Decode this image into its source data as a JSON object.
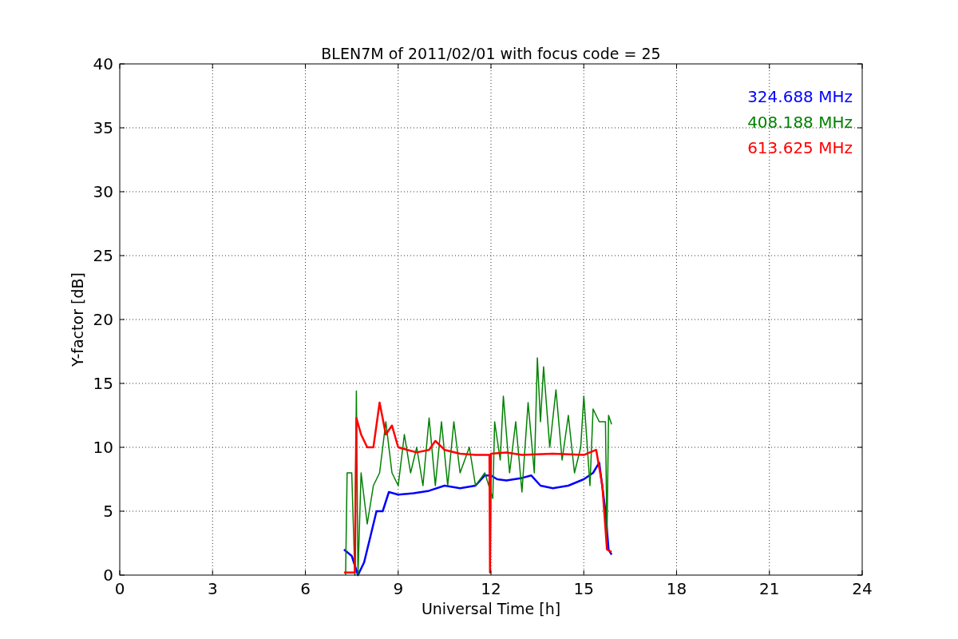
{
  "chart": {
    "chart_data": {
      "type": "line",
      "grid": true,
      "title": "BLEN7M of 2011/02/01 with focus code = 25",
      "xlabel": "Universal Time [h]",
      "ylabel": "Y-factor [dB]",
      "xlim": [
        0,
        24
      ],
      "ylim": [
        0,
        40
      ],
      "xticks": [
        0,
        3,
        6,
        9,
        12,
        15,
        18,
        21,
        24
      ],
      "yticks": [
        0,
        5,
        10,
        15,
        20,
        25,
        30,
        35,
        40
      ],
      "series": [
        {
          "name": "324.688 MHz",
          "color": "#0000ff",
          "x": [
            7.25,
            7.5,
            7.7,
            7.9,
            8.1,
            8.3,
            8.5,
            8.7,
            9,
            9.5,
            10,
            10.5,
            11,
            11.5,
            11.8,
            12,
            12.2,
            12.5,
            13,
            13.3,
            13.6,
            14,
            14.5,
            15,
            15.3,
            15.5,
            15.7,
            15.8,
            15.9
          ],
          "values": [
            2,
            1.5,
            0,
            1,
            3,
            5,
            5,
            6.5,
            6.3,
            6.4,
            6.6,
            7,
            6.8,
            7,
            7.8,
            7.8,
            7.5,
            7.4,
            7.6,
            7.8,
            7,
            6.8,
            7,
            7.5,
            8,
            8.8,
            5,
            2,
            1.6
          ]
        },
        {
          "name": "408.188 MHz",
          "color": "#008000",
          "x": [
            7.3,
            7.35,
            7.5,
            7.6,
            7.65,
            7.7,
            7.8,
            8,
            8.2,
            8.4,
            8.6,
            8.8,
            9,
            9.2,
            9.4,
            9.6,
            9.8,
            10,
            10.2,
            10.4,
            10.6,
            10.8,
            11,
            11.3,
            11.5,
            11.8,
            12.06,
            12.12,
            12.3,
            12.4,
            12.6,
            12.8,
            13,
            13.2,
            13.4,
            13.5,
            13.6,
            13.7,
            13.9,
            14.1,
            14.3,
            14.5,
            14.7,
            14.9,
            15,
            15.2,
            15.3,
            15.5,
            15.7,
            15.75,
            15.8,
            15.9
          ],
          "values": [
            0,
            8,
            8,
            0,
            14.4,
            0,
            8,
            4,
            7,
            8,
            12,
            8,
            7,
            11,
            8,
            10,
            7,
            12.3,
            7,
            12,
            7,
            12,
            8,
            10,
            7,
            8,
            6,
            12,
            9,
            14,
            8,
            12,
            6.5,
            13.5,
            8,
            17,
            12,
            16.3,
            10,
            14.5,
            9,
            12.5,
            8,
            10,
            14,
            7,
            13,
            12,
            12,
            3,
            12.5,
            11.8
          ]
        },
        {
          "name": "613.625 MHz",
          "color": "#ff0000",
          "x": [
            7.25,
            7.5,
            7.6,
            7.65,
            7.8,
            8,
            8.2,
            8.4,
            8.6,
            8.8,
            9,
            9.3,
            9.6,
            10,
            10.2,
            10.5,
            11,
            11.5,
            11.95,
            11.97,
            12,
            12.5,
            13,
            14,
            15,
            15.4,
            15.6,
            15.75,
            15.9
          ],
          "values": [
            0.2,
            0.2,
            0.2,
            12.3,
            11,
            10,
            10,
            13.5,
            11,
            11.7,
            10,
            9.8,
            9.6,
            9.8,
            10.5,
            9.8,
            9.5,
            9.4,
            9.4,
            0.2,
            9.5,
            9.6,
            9.4,
            9.5,
            9.4,
            9.8,
            7,
            2,
            1.8
          ]
        }
      ]
    }
  }
}
